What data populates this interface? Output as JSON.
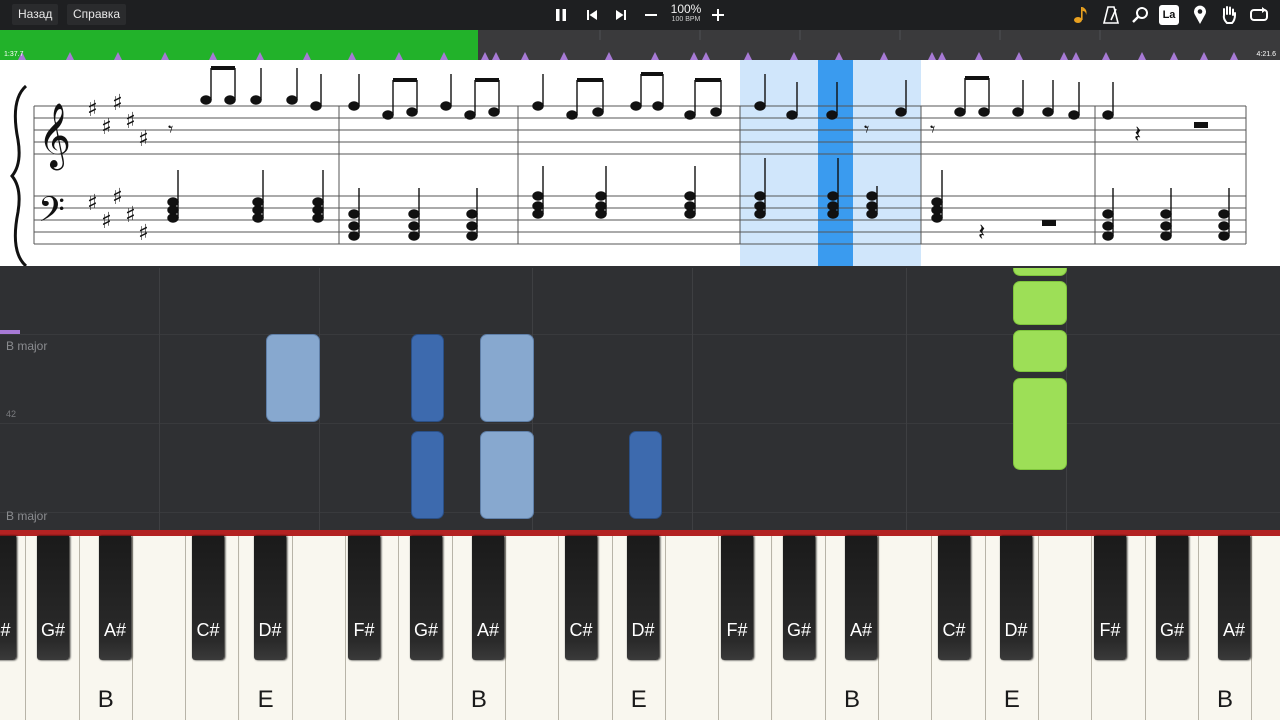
{
  "toolbar": {
    "back_label": "Назад",
    "help_label": "Справка",
    "zoom_percent": "100%",
    "tempo_bpm": "100 BPM",
    "icons": [
      "pause-icon",
      "previous-icon",
      "next-icon",
      "minus-icon",
      "plus-icon",
      "note-icon",
      "metronome-icon",
      "search-icon",
      "la-icon",
      "marker-icon",
      "hand-icon",
      "loop-icon"
    ],
    "la_label": "La"
  },
  "timeline": {
    "start_time": "1:37.7",
    "end_time": "4:21.6",
    "played_color": "#22b22a"
  },
  "piano_roll": {
    "key_top": "B major",
    "key_bottom": "B major",
    "row_number": "42"
  },
  "keyboard": {
    "black_keys": [
      "F#",
      "G#",
      "A#",
      "C#",
      "D#",
      "F#",
      "G#",
      "A#",
      "C#",
      "D#",
      "F#",
      "G#",
      "A#",
      "C#",
      "D#",
      "F#",
      "G#",
      "A#"
    ],
    "white_labels": [
      {
        "key": "B",
        "index": 2
      },
      {
        "key": "E",
        "index": 5
      },
      {
        "key": "B",
        "index": 9
      },
      {
        "key": "E",
        "index": 12
      },
      {
        "key": "B",
        "index": 16
      },
      {
        "key": "E",
        "index": 19
      },
      {
        "key": "B",
        "index": 23
      }
    ]
  }
}
